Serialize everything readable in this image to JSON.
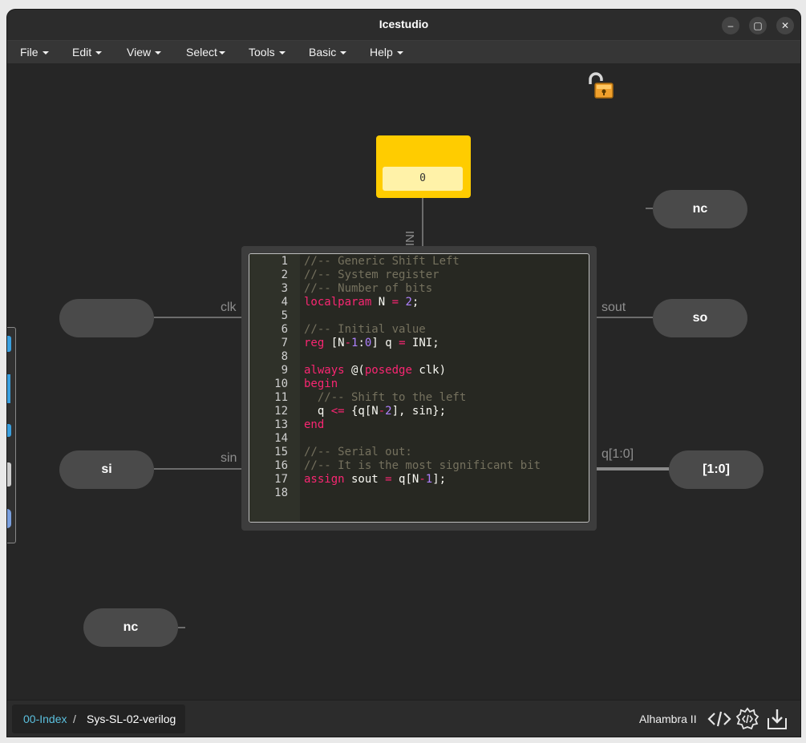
{
  "window": {
    "title": "Icestudio"
  },
  "window_controls": {
    "minimize": "–",
    "maximize": "▢",
    "close": "✕"
  },
  "menu": [
    "File",
    "Edit",
    "View",
    "Select",
    "Tools",
    "Basic",
    "Help"
  ],
  "canvas": {
    "constant": {
      "pin_label": "INI",
      "value": "0"
    },
    "inputs": [
      {
        "name": "",
        "pin": "clk"
      },
      {
        "name": "si",
        "pin": "sin"
      },
      {
        "name": "nc",
        "pin": ""
      }
    ],
    "outputs": [
      {
        "name": "nc",
        "pin": ""
      },
      {
        "name": "so",
        "pin": "sout"
      },
      {
        "name": "[1:0]",
        "pin": "q[1:0]"
      }
    ],
    "code_lines": [
      "//-- Generic Shift Left",
      "//-- System register",
      "//-- Number of bits",
      "localparam N = 2;",
      "",
      "//-- Initial value",
      "reg [N-1:0] q = INI;",
      "",
      "always @(posedge clk)",
      "begin",
      "  //-- Shift to the left",
      "  q <= {q[N-2], sin};",
      "end",
      "",
      "//-- Serial out:",
      "//-- It is the most significant bit",
      "assign sout = q[N-1];",
      ""
    ]
  },
  "status": {
    "breadcrumb_root": "00-Index",
    "breadcrumb_sep": "/",
    "breadcrumb_current": "Sys-SL-02-verilog",
    "board": "Alhambra II"
  },
  "colors": {
    "comment": "#75715e",
    "keyword": "#f92672",
    "number": "#ae81ff",
    "constant_block": "#ffcc00",
    "breadcrumb_link": "#5bc0de"
  },
  "icons": [
    "unlocked-padlock-icon",
    "code-view-icon",
    "verilog-gear-icon",
    "download-icon"
  ]
}
